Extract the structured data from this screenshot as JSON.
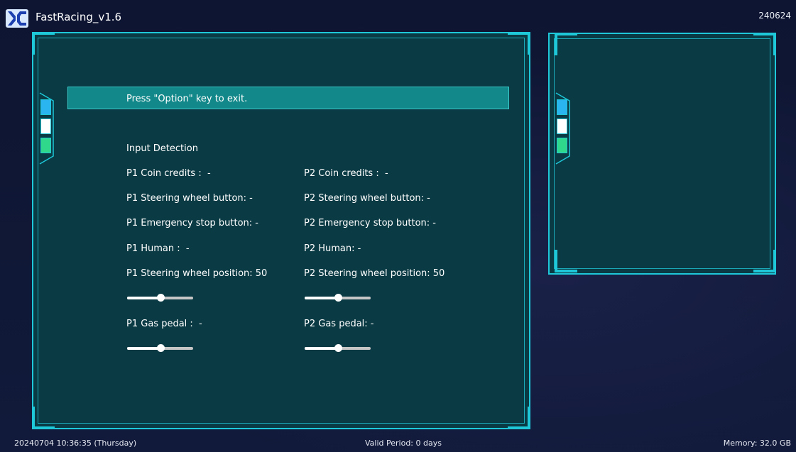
{
  "header": {
    "app_title": "FastRacing_v1.6",
    "build": "240624",
    "logo_icon": "xc-logo-icon"
  },
  "main_panel": {
    "exit_hint": "Press \"Option\" key to exit.",
    "section_title": "Input Detection",
    "p1": {
      "coin_credits": "P1 Coin credits :  -",
      "steering_button": "P1 Steering wheel button: -",
      "emergency_stop": "P1 Emergency stop button: -",
      "human": "P1 Human :  -",
      "steering_position": "P1 Steering wheel position: 50",
      "steering_value": 50,
      "gas_pedal": "P1 Gas pedal :  -",
      "gas_value": 50
    },
    "p2": {
      "coin_credits": "P2 Coin credits :  -",
      "steering_button": "P2 Steering wheel button: -",
      "emergency_stop": "P2 Emergency stop button: -",
      "human": "P2 Human: -",
      "steering_position": "P2 Steering wheel position: 50",
      "steering_value": 50,
      "gas_pedal": "P2 Gas pedal: -",
      "gas_value": 50
    }
  },
  "status_bar": {
    "datetime": "20240704 10:36:35 (Thursday)",
    "valid_period": "Valid Period: 0 days",
    "memory": "Memory: 32.0 GB"
  },
  "colors": {
    "accent": "#1ec8d8",
    "panel": "#0a3a44",
    "banner": "#13888a",
    "tab_blue": "#2ab4f0",
    "tab_white": "#ffffff",
    "tab_green": "#2fd88a"
  }
}
